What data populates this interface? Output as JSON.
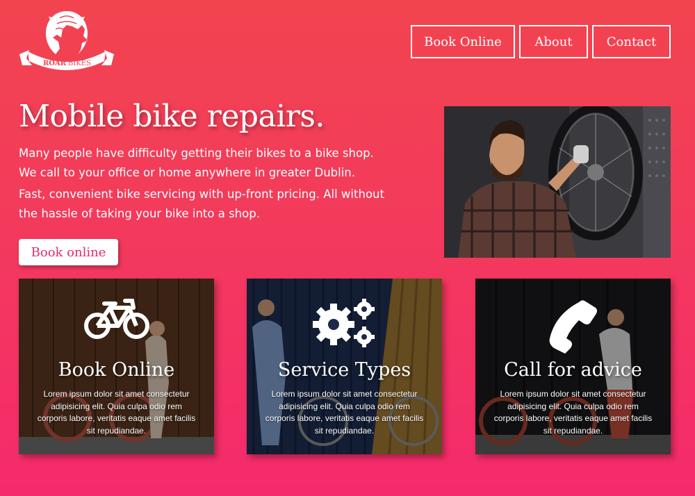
{
  "brand": {
    "logo_text_1": "ROAR",
    "logo_text_2": "BIKES",
    "accent": "#e82a68"
  },
  "nav": {
    "book_online": "Book Online",
    "about": "About",
    "contact": "Contact"
  },
  "hero": {
    "title": "Mobile bike repairs.",
    "paragraph_1": "Many people have difficulty getting their bikes to a bike shop. We call to your office or home anywhere in greater Dublin.",
    "paragraph_2": "Fast, convenient bike servicing with up-front pricing. All without the hassle of taking your bike into a shop.",
    "cta": "Book online",
    "image": "mechanic-repairing-bicycle-wheel"
  },
  "cards": [
    {
      "icon": "bicycle-icon",
      "title": "Book Online",
      "text": "Lorem ipsum dolor sit amet consectetur adipisicing elit. Quia culpa odio rem corporis labore, veritatis eaque amet facilis sit repudiandae."
    },
    {
      "icon": "gears-icon",
      "title": "Service Types",
      "text": "Lorem ipsum dolor sit amet consectetur adipisicing elit. Quia culpa odio rem corporis labore, veritatis eaque amet facilis sit repudiandae."
    },
    {
      "icon": "phone-icon",
      "title": "Call for advice",
      "text": "Lorem ipsum dolor sit amet consectetur adipisicing elit. Quia culpa odio rem corporis labore, veritatis eaque amet facilis sit repudiandae."
    }
  ]
}
